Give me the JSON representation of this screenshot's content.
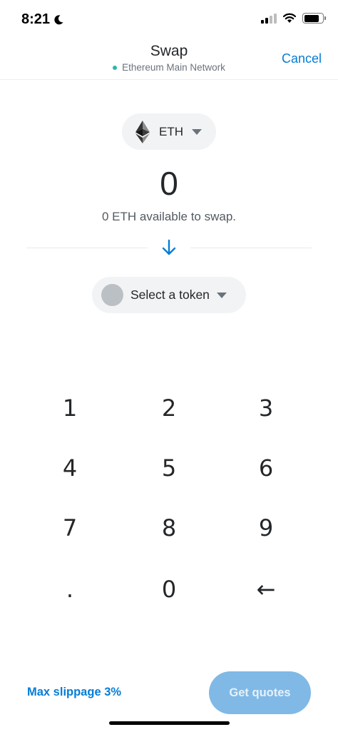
{
  "status_bar": {
    "time": "8:21"
  },
  "header": {
    "title": "Swap",
    "network": "Ethereum Main Network",
    "network_color": "#29b6af",
    "cancel_label": "Cancel"
  },
  "source_token": {
    "symbol": "ETH",
    "icon": "ethereum-icon"
  },
  "amount": "0",
  "available_text": "0 ETH available to swap.",
  "destination_token": {
    "label": "Select a token"
  },
  "keypad": {
    "keys": [
      "1",
      "2",
      "3",
      "4",
      "5",
      "6",
      "7",
      "8",
      "9",
      ".",
      "0",
      "←"
    ]
  },
  "footer": {
    "slippage_label": "Max slippage 3%",
    "get_quotes_label": "Get quotes"
  },
  "colors": {
    "accent": "#037dd6",
    "button_disabled": "#80b9e6"
  }
}
